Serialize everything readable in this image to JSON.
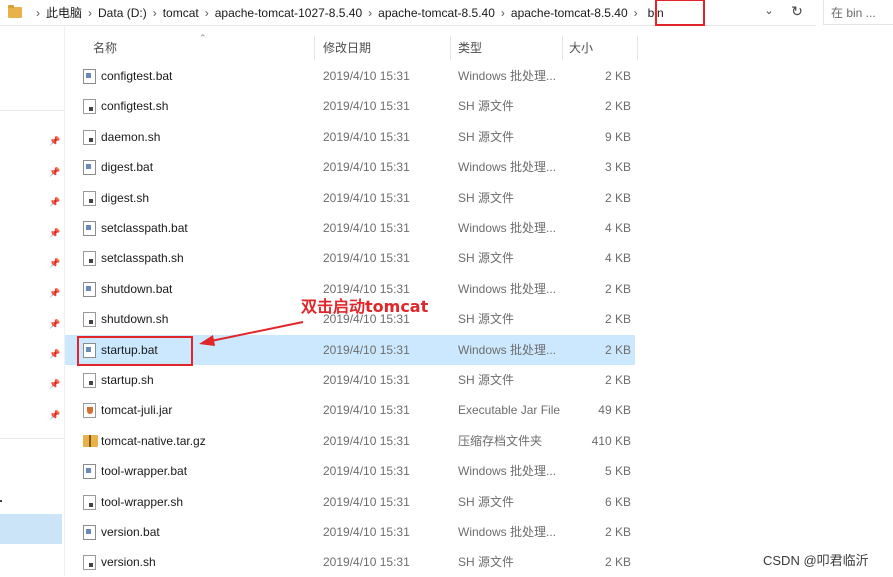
{
  "address_bar": {
    "breadcrumbs": [
      "此电脑",
      "Data (D:)",
      "tomcat",
      "apache-tomcat-1027-8.5.40",
      "apache-tomcat-8.5.40",
      "apache-tomcat-8.5.40",
      "bin"
    ],
    "search_placeholder": "在 bin ..."
  },
  "columns": {
    "name": "名称",
    "date": "修改日期",
    "type": "类型",
    "size": "大小"
  },
  "files": [
    {
      "name": "configtest.bat",
      "date": "2019/4/10 15:31",
      "type": "Windows 批处理...",
      "size": "2 KB",
      "icon": "bat-file-icon"
    },
    {
      "name": "configtest.sh",
      "date": "2019/4/10 15:31",
      "type": "SH 源文件",
      "size": "2 KB",
      "icon": "sh-file-icon"
    },
    {
      "name": "daemon.sh",
      "date": "2019/4/10 15:31",
      "type": "SH 源文件",
      "size": "9 KB",
      "icon": "sh-file-icon"
    },
    {
      "name": "digest.bat",
      "date": "2019/4/10 15:31",
      "type": "Windows 批处理...",
      "size": "3 KB",
      "icon": "bat-file-icon"
    },
    {
      "name": "digest.sh",
      "date": "2019/4/10 15:31",
      "type": "SH 源文件",
      "size": "2 KB",
      "icon": "sh-file-icon"
    },
    {
      "name": "setclasspath.bat",
      "date": "2019/4/10 15:31",
      "type": "Windows 批处理...",
      "size": "4 KB",
      "icon": "bat-file-icon"
    },
    {
      "name": "setclasspath.sh",
      "date": "2019/4/10 15:31",
      "type": "SH 源文件",
      "size": "4 KB",
      "icon": "sh-file-icon"
    },
    {
      "name": "shutdown.bat",
      "date": "2019/4/10 15:31",
      "type": "Windows 批处理...",
      "size": "2 KB",
      "icon": "bat-file-icon"
    },
    {
      "name": "shutdown.sh",
      "date": "2019/4/10 15:31",
      "type": "SH 源文件",
      "size": "2 KB",
      "icon": "sh-file-icon"
    },
    {
      "name": "startup.bat",
      "date": "2019/4/10 15:31",
      "type": "Windows 批处理...",
      "size": "2 KB",
      "icon": "bat-file-icon",
      "selected": true
    },
    {
      "name": "startup.sh",
      "date": "2019/4/10 15:31",
      "type": "SH 源文件",
      "size": "2 KB",
      "icon": "sh-file-icon"
    },
    {
      "name": "tomcat-juli.jar",
      "date": "2019/4/10 15:31",
      "type": "Executable Jar File",
      "size": "49 KB",
      "icon": "jar-file-icon"
    },
    {
      "name": "tomcat-native.tar.gz",
      "date": "2019/4/10 15:31",
      "type": "压缩存档文件夹",
      "size": "410 KB",
      "icon": "archive-folder-icon"
    },
    {
      "name": "tool-wrapper.bat",
      "date": "2019/4/10 15:31",
      "type": "Windows 批处理...",
      "size": "5 KB",
      "icon": "bat-file-icon"
    },
    {
      "name": "tool-wrapper.sh",
      "date": "2019/4/10 15:31",
      "type": "SH 源文件",
      "size": "6 KB",
      "icon": "sh-file-icon"
    },
    {
      "name": "version.bat",
      "date": "2019/4/10 15:31",
      "type": "Windows 批处理...",
      "size": "2 KB",
      "icon": "bat-file-icon"
    },
    {
      "name": "version.sh",
      "date": "2019/4/10 15:31",
      "type": "SH 源文件",
      "size": "2 KB",
      "icon": "sh-file-icon"
    }
  ],
  "annotation": {
    "text": "双击启动tomcat",
    "color": "#e0262a"
  },
  "watermark": "CSDN @叩君临沂",
  "colors": {
    "selection": "#cce8ff",
    "highlight_border": "#e0262a",
    "folder": "#e8b24a"
  }
}
